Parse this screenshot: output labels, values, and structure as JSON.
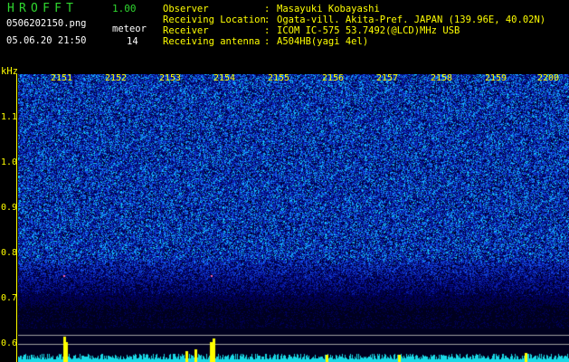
{
  "header": {
    "title": "HROFFT",
    "version": "1.00",
    "filename": "0506202150.png",
    "datetime": "05.06.20 21:50",
    "meteor_label": "meteor",
    "meteor_count": "14"
  },
  "info": [
    {
      "key": "Observer",
      "sep": ":",
      "value": "Masayuki Kobayashi"
    },
    {
      "key": "Receiving Location",
      "sep": ":",
      "value": "Ogata-vill. Akita-Pref. JAPAN (139.96E, 40.02N)"
    },
    {
      "key": "Receiver",
      "sep": ":",
      "value": "ICOM IC-575 53.7492(@LCD)MHz USB"
    },
    {
      "key": "Receiving antenna",
      "sep": ":",
      "value": "A504HB(yagi 4el)"
    }
  ],
  "spectrogram": {
    "unit": "kHz",
    "y_labels": [
      "1.1",
      "1.0",
      "0.9",
      "0.8",
      "0.7",
      "0.6"
    ],
    "x_labels": [
      "2151",
      "2152",
      "2153",
      "2154",
      "2155",
      "2156",
      "2157",
      "2158",
      "2159",
      "2200"
    ],
    "colors": {
      "text": "#ffff00",
      "labels": "#2fd72f",
      "background_low": "#000010",
      "background_high": "#1a3cff"
    }
  }
}
